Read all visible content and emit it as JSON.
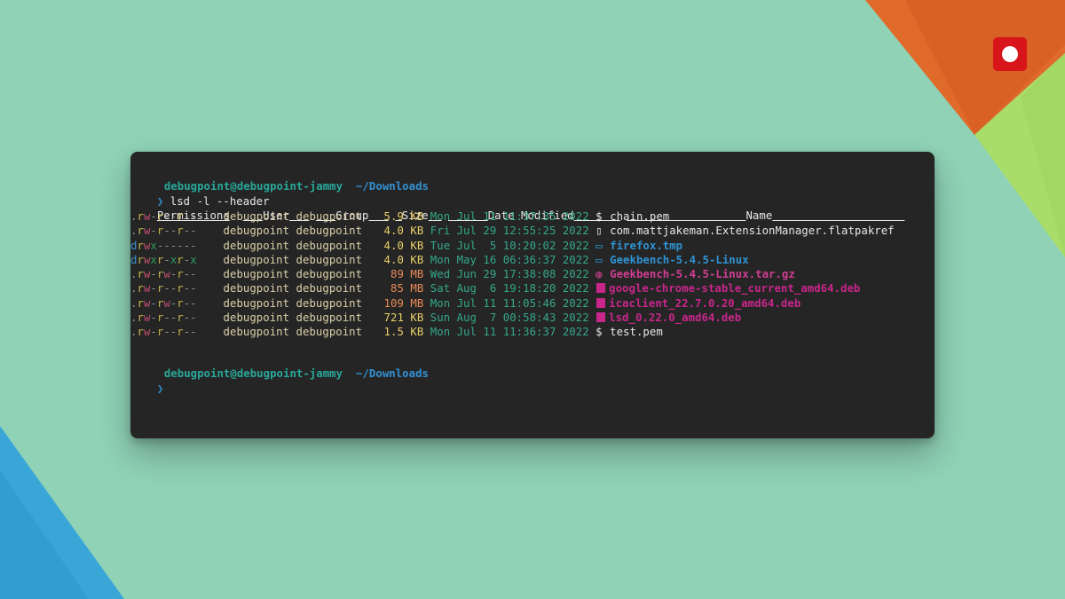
{
  "colors": {
    "background": "#8fd2b6",
    "terminal_bg": "#252525",
    "prompt": "#29a899",
    "directory": "#3391d2",
    "record_button": "#d7151a"
  },
  "prompt": {
    "user_host": "debugpoint@debugpoint-jammy",
    "path": "~/Downloads",
    "chevron": "❯",
    "command": "lsd -l --header"
  },
  "headers": {
    "permissions": "Permissions",
    "user": "User",
    "group": "Group",
    "size": "Size",
    "date": "Date Modified",
    "name": "Name"
  },
  "rows": [
    {
      "perm": [
        ".",
        "r",
        "w",
        "-",
        "r",
        "-",
        "-",
        "r",
        "-",
        "-"
      ],
      "user": "debugpoint",
      "group": "debugpoint",
      "size": "5.9",
      "unit": "KB",
      "date": "Mon Jul 11 11:37:35 2022",
      "icon": "key-icon",
      "name": "chain.pem",
      "type": "file"
    },
    {
      "perm": [
        ".",
        "r",
        "w",
        "-",
        "r",
        "-",
        "-",
        "r",
        "-",
        "-"
      ],
      "user": "debugpoint",
      "group": "debugpoint",
      "size": "4.0",
      "unit": "KB",
      "date": "Fri Jul 29 12:55:25 2022",
      "icon": "file-icon",
      "name": "com.mattjakeman.ExtensionManager.flatpakref",
      "type": "file"
    },
    {
      "perm": [
        "d",
        "r",
        "w",
        "x",
        "-",
        "-",
        "-",
        "-",
        "-",
        "-"
      ],
      "user": "debugpoint",
      "group": "debugpoint",
      "size": "4.0",
      "unit": "KB",
      "date": "Tue Jul  5 10:20:02 2022",
      "icon": "folder-open-icon",
      "name": "firefox.tmp",
      "type": "folder"
    },
    {
      "perm": [
        "d",
        "r",
        "w",
        "x",
        "r",
        "-",
        "x",
        "r",
        "-",
        "x"
      ],
      "user": "debugpoint",
      "group": "debugpoint",
      "size": "4.0",
      "unit": "KB",
      "date": "Mon May 16 06:36:37 2022",
      "icon": "folder-open-icon",
      "name": "Geekbench-5.4.5-Linux",
      "type": "folder"
    },
    {
      "perm": [
        ".",
        "r",
        "w",
        "-",
        "r",
        "w",
        "-",
        "r",
        "-",
        "-"
      ],
      "user": "debugpoint",
      "group": "debugpoint",
      "size": "89",
      "unit": "MB",
      "date": "Wed Jun 29 17:38:08 2022",
      "icon": "archive-icon",
      "name": "Geekbench-5.4.5-Linux.tar.gz",
      "type": "archive"
    },
    {
      "perm": [
        ".",
        "r",
        "w",
        "-",
        "r",
        "-",
        "-",
        "r",
        "-",
        "-"
      ],
      "user": "debugpoint",
      "group": "debugpoint",
      "size": "85",
      "unit": "MB",
      "date": "Sat Aug  6 19:18:20 2022",
      "icon": "package-icon",
      "name": "google-chrome-stable_current_amd64.deb",
      "type": "deb"
    },
    {
      "perm": [
        ".",
        "r",
        "w",
        "-",
        "r",
        "w",
        "-",
        "r",
        "-",
        "-"
      ],
      "user": "debugpoint",
      "group": "debugpoint",
      "size": "109",
      "unit": "MB",
      "date": "Mon Jul 11 11:05:46 2022",
      "icon": "package-icon",
      "name": "icaclient_22.7.0.20_amd64.deb",
      "type": "deb"
    },
    {
      "perm": [
        ".",
        "r",
        "w",
        "-",
        "r",
        "-",
        "-",
        "r",
        "-",
        "-"
      ],
      "user": "debugpoint",
      "group": "debugpoint",
      "size": "721",
      "unit": "KB",
      "date": "Sun Aug  7 00:58:43 2022",
      "icon": "package-icon",
      "name": "lsd_0.22.0_amd64.deb",
      "type": "deb"
    },
    {
      "perm": [
        ".",
        "r",
        "w",
        "-",
        "r",
        "-",
        "-",
        "r",
        "-",
        "-"
      ],
      "user": "debugpoint",
      "group": "debugpoint",
      "size": "1.5",
      "unit": "KB",
      "date": "Mon Jul 11 11:36:37 2022",
      "icon": "key-icon",
      "name": "test.pem",
      "type": "file"
    }
  ]
}
